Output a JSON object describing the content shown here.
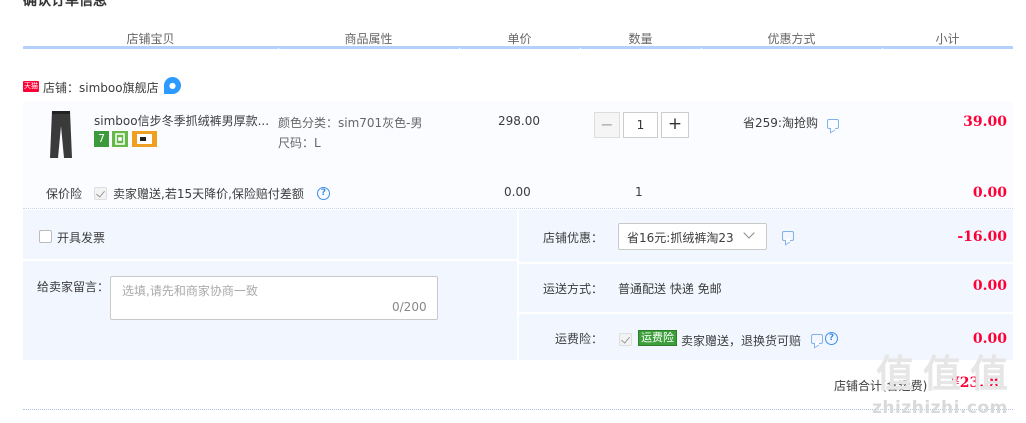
{
  "page": {
    "title": "确认订单信息"
  },
  "columns": [
    "店铺宝贝",
    "商品属性",
    "单价",
    "数量",
    "优惠方式",
    "小计"
  ],
  "store": {
    "tmall_badge": "天猫",
    "label": "店铺：simboo旗舰店"
  },
  "item": {
    "title": "simboo信步冬季抓绒裤男厚款...",
    "badges": [
      "7"
    ],
    "props": [
      "颜色分类：sim701灰色-男",
      "尺码：L"
    ],
    "unit_price": "298.00",
    "quantity": "1",
    "discount": "省259:淘抢购",
    "subtotal": "39.00"
  },
  "insurance": {
    "label": "保价险",
    "desc": "卖家赠送,若15天降价,保险赔付差额",
    "price": "0.00",
    "quantity": "1",
    "subtotal": "0.00"
  },
  "invoice": {
    "label": "开具发票"
  },
  "message": {
    "label": "给卖家留言：",
    "placeholder": "选填,请先和商家协商一致",
    "count": "0/200"
  },
  "store_discount": {
    "label": "店铺优惠：",
    "selected": "省16元:抓绒裤淘23",
    "value": "-16.00"
  },
  "shipping": {
    "label": "运送方式：",
    "method": "普通配送 快递 免邮",
    "value": "0.00"
  },
  "return_ins": {
    "label": "运费险：",
    "badge": "运费险",
    "desc": "卖家赠送，退换货可赔",
    "value": "0.00"
  },
  "total": {
    "label": "店铺合计(含运费)",
    "value": "¥23.00"
  },
  "watermark": {
    "text": "zhizhizhi.com",
    "glyph": "值"
  },
  "colors": {
    "accent_red": "#ff0036",
    "header_line": "#b2d1ff",
    "panel_bg": "#f2f7ff",
    "link_blue": "#3d8ee8"
  }
}
